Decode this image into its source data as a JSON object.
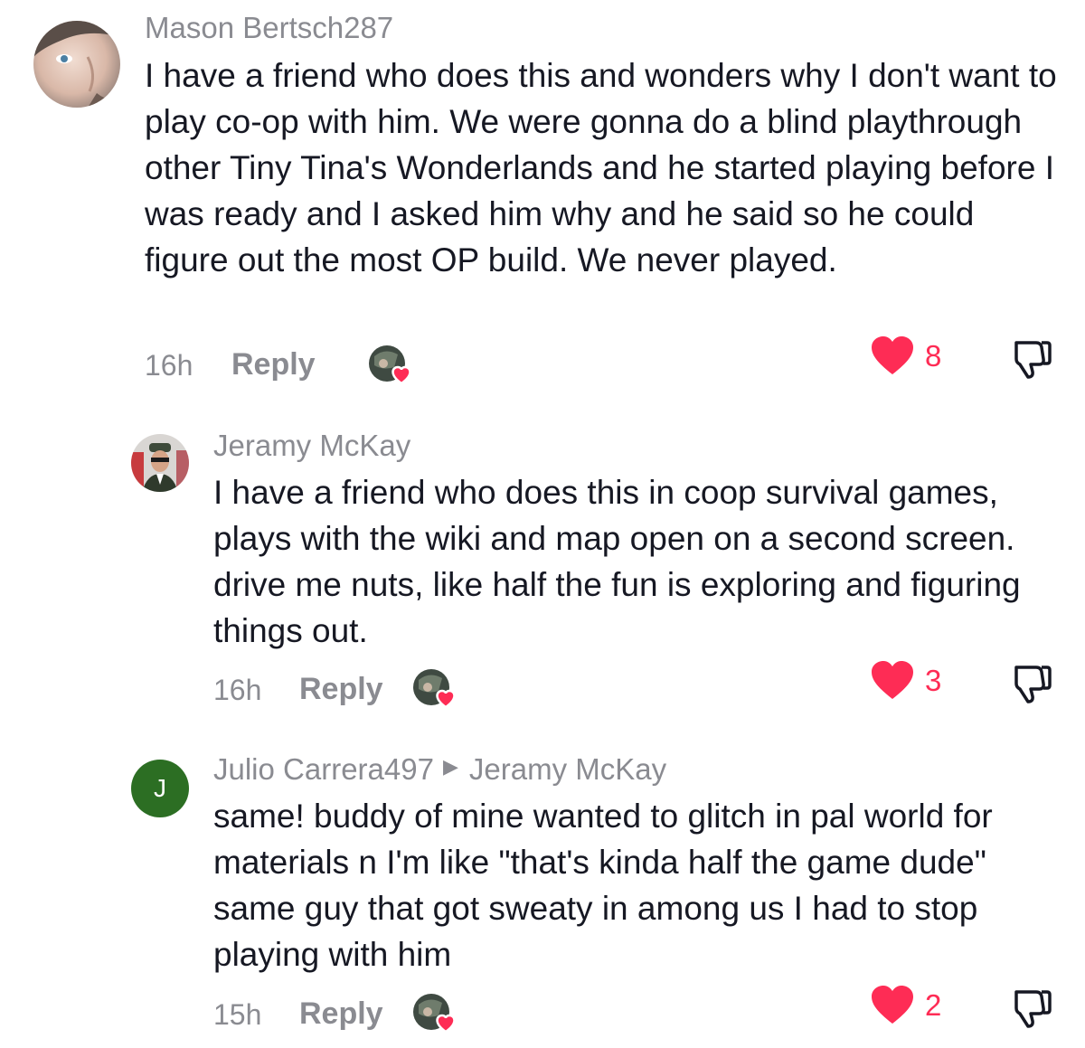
{
  "comments": [
    {
      "username": "Mason Bertsch287",
      "text": "I have a friend who does this and wonders why I don't want to play co-op with him. We were gonna do a blind playthrough other Tiny Tina's Wonderlands and he started playing before I was ready and I asked him why and he said so he could figure out the most OP build. We never played.",
      "time": "16h",
      "reply_label": "Reply",
      "likes": "8"
    },
    {
      "username": "Jeramy McKay",
      "text": "I have a friend who does this in coop survival games, plays with the wiki and map open on a second screen. drive me nuts, like half the fun is exploring and figuring things out.",
      "time": "16h",
      "reply_label": "Reply",
      "likes": "3"
    },
    {
      "username": "Julio Carrera497",
      "reply_to": "Jeramy McKay",
      "avatar_letter": "J",
      "text": "same! buddy of mine wanted to glitch in pal world for materials n I'm like \"that's kinda half the game dude\" same guy that got sweaty in among us I had to stop playing with him",
      "time": "15h",
      "reply_label": "Reply",
      "likes": "2"
    }
  ],
  "colors": {
    "like_red": "#fe2c55",
    "meta_gray": "#8a8b91",
    "text": "#161823",
    "letter_avatar_bg": "#2c6e23"
  },
  "icons": {
    "like": "heart-icon",
    "dislike": "thumbs-down-icon",
    "reply_arrow": "play-arrow-icon",
    "creator_liked": "creator-liked-badge-icon"
  }
}
